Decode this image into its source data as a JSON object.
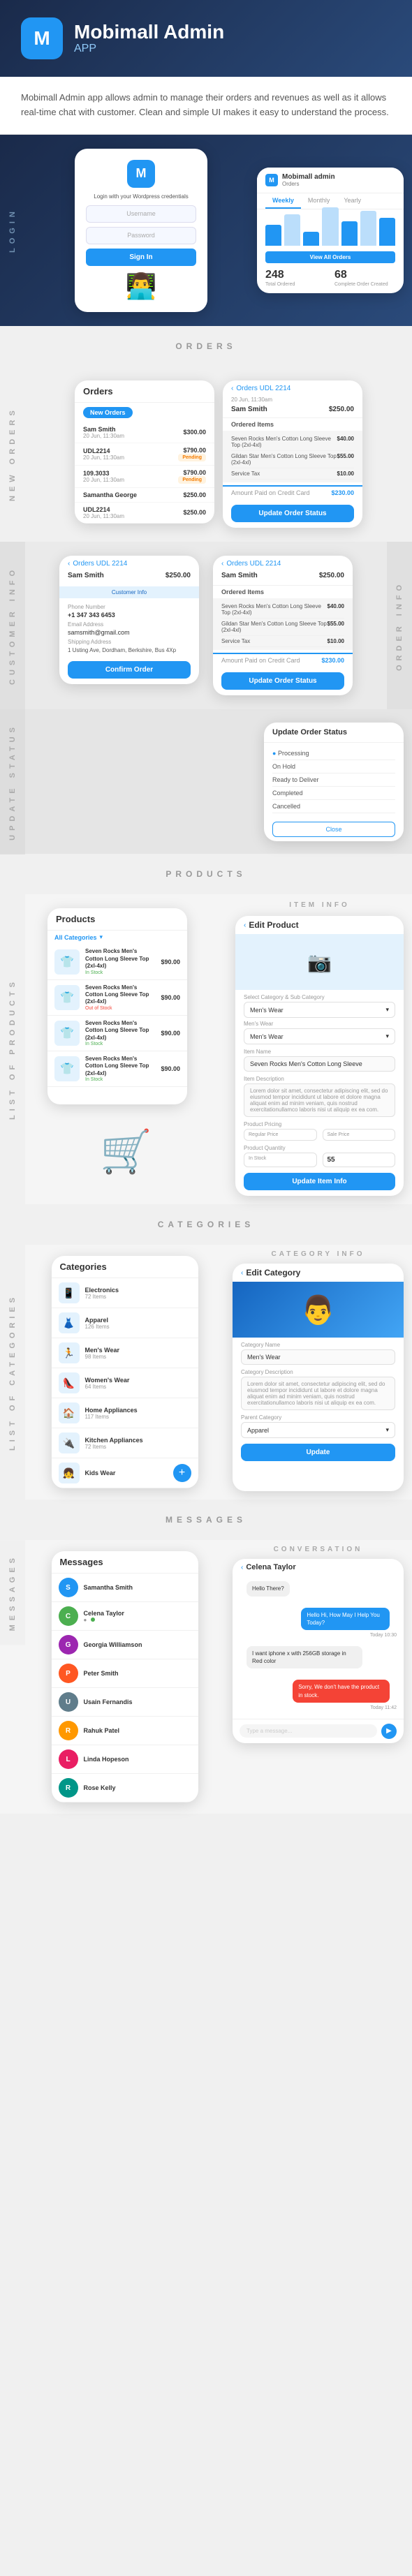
{
  "header": {
    "logo_letter": "M",
    "title": "Mobimall Admin",
    "subtitle": "APP"
  },
  "intro": {
    "text": "Mobimall Admin app allows admin to manage their orders and revenues as well as it allows real-time chat with customer. Clean and simple UI makes it easy to understand the process."
  },
  "sections": {
    "login_label": "LOGIN",
    "orders_label": "ORDERS",
    "new_orders_label": "NEW ORDERS",
    "customer_info_label": "CUSTOMER INFO",
    "order_info_label": "ORDER INFO",
    "update_status_label": "UPDATE STATUS",
    "products_label": "PRODUCTS",
    "list_of_products_label": "LIST OF PRODUCTS",
    "item_info_label": "ITEM INFO",
    "categories_label": "CATEGORIES",
    "list_of_categories_label": "LIST OF CATEGORIES",
    "category_info_label": "CATEGORY INFO",
    "messages_label": "MESSAGES",
    "conversation_label": "CONVERSATION"
  },
  "dashboard": {
    "title": "Mobimall admin",
    "subtitle": "Orders",
    "tabs": [
      "Weekly",
      "Monthly",
      "Yearly"
    ],
    "active_tab": "Weekly",
    "view_all": "View All Orders",
    "stats": [
      {
        "num": "248",
        "label": "Total Ordered"
      },
      {
        "num": "68",
        "label": "Complete Order Created"
      }
    ],
    "bar_heights": [
      30,
      45,
      20,
      55,
      35,
      50,
      40
    ]
  },
  "login": {
    "title": "M",
    "prompt": "Login with your Wordpress credentials",
    "username_placeholder": "Username",
    "password_placeholder": "Password",
    "button": "Sign In"
  },
  "orders_list": {
    "title": "Orders",
    "tab": "New Orders",
    "items": [
      {
        "id": "Sam Smith",
        "date": "20 Jun, 11:30am",
        "amount": "$300.00",
        "status": ""
      },
      {
        "id": "UDL2214",
        "date": "20 Jun, 11:30am",
        "amount": "$790.00",
        "status": "Pending"
      },
      {
        "id": "109.3033",
        "date": "20 Jun, 11:30am",
        "amount": "$790.00",
        "status": "Pending"
      },
      {
        "id": "Samantha George",
        "date": "",
        "amount": "$250.00",
        "status": ""
      },
      {
        "id": "UDL2214",
        "date": "20 Jun, 11:30am",
        "amount": "$250.00",
        "status": ""
      }
    ]
  },
  "order_detail": {
    "back": "Orders UDL 2214",
    "date": "20 Jun, 11:30am",
    "customer": "Sam Smith",
    "amount": "$250.00",
    "section": "Ordered Items",
    "items": [
      {
        "name": "Seven Rocks Men's Cotton Long Sleeve Top (2xl-4xl)",
        "price": "$40.00"
      },
      {
        "name": "Gildan Star Men's Cotton Long Sleeve Top (2xl-4xl)",
        "price": "$55.00"
      },
      {
        "name": "Service Tax",
        "price": "$10.00"
      }
    ],
    "total_label": "Amount Paid on Credit Card",
    "total": "$230.00",
    "update_btn": "Update Order Status"
  },
  "customer_info": {
    "title": "Orders UDL 2214",
    "customer": "Sam Smith",
    "amount": "$250.00",
    "tab": "Customer Info",
    "phone_label": "Phone Number",
    "phone": "+1 347 343 6453",
    "email_label": "Email Address",
    "email": "samsmith@gmail.com",
    "shipping_label": "Shipping Address",
    "shipping": "1 Usting Ave, Dordham, Berkshire, Bus 4Xp",
    "confirm_btn": "Confirm Order"
  },
  "update_status": {
    "title": "Update Order Status",
    "options": [
      "Processing",
      "On Hold",
      "Ready to Deliver",
      "Completed",
      "Cancelled"
    ],
    "close": "Close"
  },
  "products_list": {
    "title": "Products",
    "category": "All Categories",
    "items": [
      {
        "name": "Seven Rocks Men's Cotton Long Sleeve Top (2xl-4xl)",
        "price": "$90.00",
        "stock": "In Stock"
      },
      {
        "name": "Seven Rocks Men's Cotton Long Sleeve Top (2xl-4xl)",
        "price": "$90.00",
        "stock": "Out of Stock"
      },
      {
        "name": "Seven Rocks Men's Cotton Long Sleeve Top (2xl-4xl)",
        "price": "$90.00",
        "stock": "In Stock"
      },
      {
        "name": "Seven Rocks Men's Cotton Long Sleeve Top (2xl-4xl)",
        "price": "$90.00",
        "stock": "In Stock"
      }
    ]
  },
  "edit_product": {
    "title": "Edit Product",
    "category_label": "Select Category & Sub Category",
    "category": "Men's Wear",
    "name_label": "Item Name",
    "name": "Seven Rocks Men's Cotton Long Sleeve",
    "description_label": "Item Description",
    "description": "Lorem dolor sit amet, consectetur adipiscing elit, sed do eiusmod tempor incididunt ut labore et dolore magna aliquat enim ad minim veniam, quis nostrud exercitationullamco laboris nisi ut aliquip ex ea com.",
    "pricing_label": "Product Pricing",
    "regular_price": "Regular Price",
    "sale_price": "Sale Price",
    "quantity_label": "Product Quantity",
    "in_stock": "In Stock",
    "quantity": "55",
    "update_btn": "Update Item Info"
  },
  "categories_list": {
    "title": "Categories",
    "items": [
      {
        "icon": "👕",
        "name": "Electronics",
        "count": "72 Items"
      },
      {
        "icon": "👗",
        "name": "Apparel",
        "count": "126 Items"
      },
      {
        "icon": "🏃",
        "name": "Men's Wear",
        "count": "98 Items"
      },
      {
        "icon": "👠",
        "name": "Women's Wear",
        "count": "64 Items"
      },
      {
        "icon": "🏠",
        "name": "Home Appliances",
        "count": "117 Items"
      },
      {
        "icon": "🔌",
        "name": "Kitchen Appliances",
        "count": "72 Items"
      },
      {
        "icon": "👧",
        "name": "Kids Wear",
        "count": ""
      }
    ]
  },
  "edit_category": {
    "title": "Edit Category",
    "name_label": "Category Name",
    "name": "Men's Wear",
    "description_label": "Category Description",
    "description": "Lorem dolor sit amet, consectetur adipiscing elit, sed do eiusmod tempor incididunt ut labore et dolore magna aliquat enim ad minim veniam, quis nostrud exercitationullamco laboris nisi ut aliquip ex ea com.",
    "parent_label": "Parent Category",
    "parent": "Apparel",
    "update_btn": "Update"
  },
  "messages": {
    "title": "Messages",
    "items": [
      {
        "name": "Samantha Smith",
        "preview": "",
        "time": ""
      },
      {
        "name": "Celena Taylor",
        "preview": "",
        "time": ""
      },
      {
        "name": "Georgia Williamson",
        "preview": "",
        "time": ""
      },
      {
        "name": "Peter Smith",
        "preview": "",
        "time": ""
      },
      {
        "name": "Usain Fernandis",
        "preview": "",
        "time": ""
      },
      {
        "name": "Rahuk Patel",
        "preview": "",
        "time": ""
      },
      {
        "name": "Linda Hopeson",
        "preview": "",
        "time": ""
      },
      {
        "name": "Rose Kelly",
        "preview": "",
        "time": ""
      }
    ]
  },
  "conversation": {
    "title": "Celena Taylor",
    "messages": [
      {
        "type": "received",
        "text": "Hello There?",
        "time": ""
      },
      {
        "type": "sent",
        "text": "Hello Hi, How May I Help You Today?",
        "time": "Today 10:30"
      },
      {
        "type": "received",
        "text": "I want iphone x with 256GB storage in Red color",
        "time": ""
      },
      {
        "type": "error",
        "text": "Sorry, We don't have the product in stock.",
        "time": "Today 11:42"
      }
    ]
  }
}
